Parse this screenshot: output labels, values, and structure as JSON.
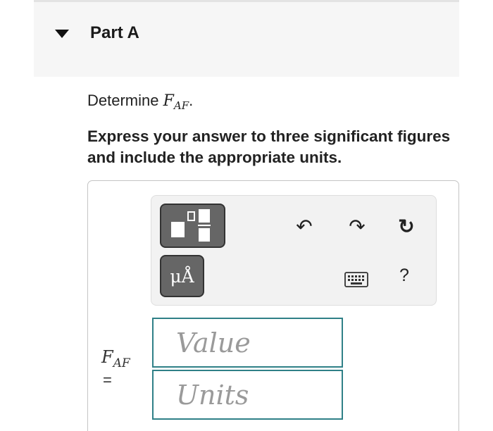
{
  "part": {
    "title": "Part A"
  },
  "question": {
    "prefix": "Determine ",
    "var": "F",
    "sub": "AF",
    "suffix": "."
  },
  "instructions": "Express your answer to three significant figures and include the appropriate units.",
  "toolbar": {
    "units_button_label": "μÅ",
    "help_label": "?"
  },
  "answer": {
    "var": "F",
    "sub": "AF",
    "equals": "=",
    "value_placeholder": "Value",
    "units_placeholder": "Units"
  },
  "icons": {
    "collapse": "caret-down-icon",
    "templates": "templates-icon",
    "undo": "undo-icon",
    "redo": "redo-icon",
    "reset": "reset-icon",
    "keyboard": "keyboard-icon",
    "help": "help-icon"
  },
  "colors": {
    "field_border": "#2f8087",
    "button_fill": "#666666"
  }
}
